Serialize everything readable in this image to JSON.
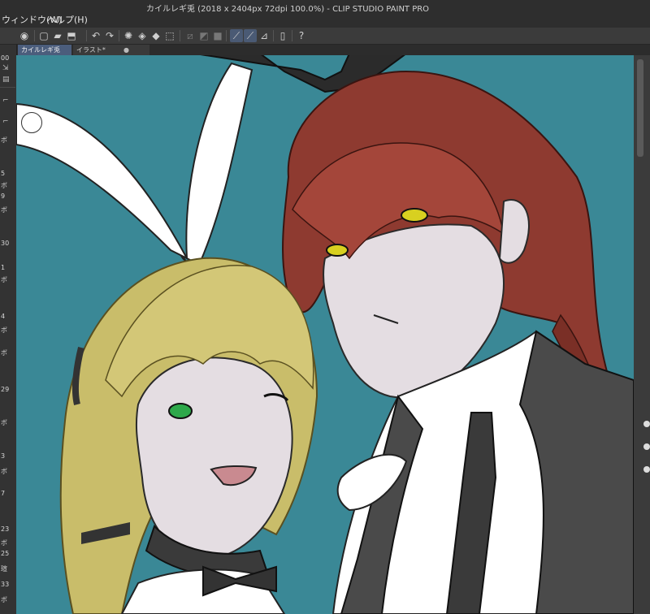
{
  "app": {
    "title": "カイルレギ兎 (2018 x 2404px 72dpi 100.0%) - CLIP STUDIO PAINT PRO"
  },
  "menu": {
    "items": [
      {
        "label": "ウィンドウ(W)"
      },
      {
        "label": "ヘルプ(H)"
      }
    ]
  },
  "toolbar": {
    "icons": [
      "eye-icon",
      "new-file-icon",
      "open-folder-icon",
      "save-icon",
      "undo-icon",
      "redo-icon",
      "loading-icon",
      "fill-icon",
      "transform-icon",
      "clear-icon",
      "fill-rect-icon",
      "snap-ruler-icon",
      "snap-line-icon",
      "snap-grid-icon",
      "ink-icon",
      "device-icon",
      "help-icon"
    ]
  },
  "tabs": [
    {
      "label": "カイルレギ兎",
      "active": true
    },
    {
      "label": "イラスト*",
      "active": false
    }
  ],
  "left_panel": {
    "top_value": "00",
    "labels": [
      "ボ",
      "5",
      "ボ",
      "9",
      "ボ",
      "30",
      "1",
      "ボ",
      "4",
      "ボ",
      "ボ",
      "29",
      "ボ",
      "3",
      "ボ",
      "7",
      "23",
      "ボ",
      "25",
      "瑄",
      "33",
      "ボ"
    ]
  },
  "canvas": {
    "background_color": "#3a8896",
    "description_colors": {
      "hair_red": "#8e3a30",
      "hair_blonde": "#c9bd6a",
      "skin": "#e4dde2",
      "vest": "#4a4a4a",
      "eyes_yellow": "#d8d020",
      "eyes_green": "#2ea84a"
    }
  }
}
